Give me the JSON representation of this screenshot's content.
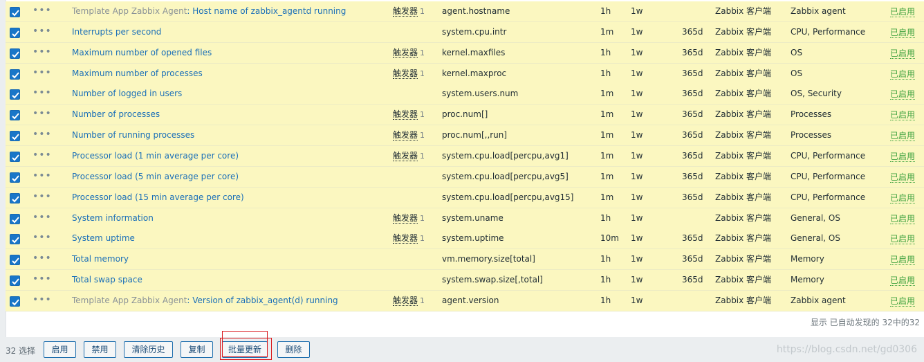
{
  "rows": [
    {
      "checked": true,
      "prefix": "Template App Zabbix Agent",
      "name": "Host name of zabbix_agentd running",
      "trigger_label": "触发器",
      "trigger_count": "1",
      "key": "agent.hostname",
      "interval": "1h",
      "history": "1w",
      "trends": "",
      "type": "Zabbix 客户端",
      "apps": "Zabbix agent",
      "status": "已启用"
    },
    {
      "checked": true,
      "prefix": "",
      "name": "Interrupts per second",
      "trigger_label": "",
      "trigger_count": "",
      "key": "system.cpu.intr",
      "interval": "1m",
      "history": "1w",
      "trends": "365d",
      "type": "Zabbix 客户端",
      "apps": "CPU, Performance",
      "status": "已启用"
    },
    {
      "checked": true,
      "prefix": "",
      "name": "Maximum number of opened files",
      "trigger_label": "触发器",
      "trigger_count": "1",
      "key": "kernel.maxfiles",
      "interval": "1h",
      "history": "1w",
      "trends": "365d",
      "type": "Zabbix 客户端",
      "apps": "OS",
      "status": "已启用"
    },
    {
      "checked": true,
      "prefix": "",
      "name": "Maximum number of processes",
      "trigger_label": "触发器",
      "trigger_count": "1",
      "key": "kernel.maxproc",
      "interval": "1h",
      "history": "1w",
      "trends": "365d",
      "type": "Zabbix 客户端",
      "apps": "OS",
      "status": "已启用"
    },
    {
      "checked": true,
      "prefix": "",
      "name": "Number of logged in users",
      "trigger_label": "",
      "trigger_count": "",
      "key": "system.users.num",
      "interval": "1m",
      "history": "1w",
      "trends": "365d",
      "type": "Zabbix 客户端",
      "apps": "OS, Security",
      "status": "已启用"
    },
    {
      "checked": true,
      "prefix": "",
      "name": "Number of processes",
      "trigger_label": "触发器",
      "trigger_count": "1",
      "key": "proc.num[]",
      "interval": "1m",
      "history": "1w",
      "trends": "365d",
      "type": "Zabbix 客户端",
      "apps": "Processes",
      "status": "已启用"
    },
    {
      "checked": true,
      "prefix": "",
      "name": "Number of running processes",
      "trigger_label": "触发器",
      "trigger_count": "1",
      "key": "proc.num[,,run]",
      "interval": "1m",
      "history": "1w",
      "trends": "365d",
      "type": "Zabbix 客户端",
      "apps": "Processes",
      "status": "已启用"
    },
    {
      "checked": true,
      "prefix": "",
      "name": "Processor load (1 min average per core)",
      "trigger_label": "触发器",
      "trigger_count": "1",
      "key": "system.cpu.load[percpu,avg1]",
      "interval": "1m",
      "history": "1w",
      "trends": "365d",
      "type": "Zabbix 客户端",
      "apps": "CPU, Performance",
      "status": "已启用"
    },
    {
      "checked": true,
      "prefix": "",
      "name": "Processor load (5 min average per core)",
      "trigger_label": "",
      "trigger_count": "",
      "key": "system.cpu.load[percpu,avg5]",
      "interval": "1m",
      "history": "1w",
      "trends": "365d",
      "type": "Zabbix 客户端",
      "apps": "CPU, Performance",
      "status": "已启用"
    },
    {
      "checked": true,
      "prefix": "",
      "name": "Processor load (15 min average per core)",
      "trigger_label": "",
      "trigger_count": "",
      "key": "system.cpu.load[percpu,avg15]",
      "interval": "1m",
      "history": "1w",
      "trends": "365d",
      "type": "Zabbix 客户端",
      "apps": "CPU, Performance",
      "status": "已启用"
    },
    {
      "checked": true,
      "prefix": "",
      "name": "System information",
      "trigger_label": "触发器",
      "trigger_count": "1",
      "key": "system.uname",
      "interval": "1h",
      "history": "1w",
      "trends": "",
      "type": "Zabbix 客户端",
      "apps": "General, OS",
      "status": "已启用"
    },
    {
      "checked": true,
      "prefix": "",
      "name": "System uptime",
      "trigger_label": "触发器",
      "trigger_count": "1",
      "key": "system.uptime",
      "interval": "10m",
      "history": "1w",
      "trends": "365d",
      "type": "Zabbix 客户端",
      "apps": "General, OS",
      "status": "已启用"
    },
    {
      "checked": true,
      "prefix": "",
      "name": "Total memory",
      "trigger_label": "",
      "trigger_count": "",
      "key": "vm.memory.size[total]",
      "interval": "1h",
      "history": "1w",
      "trends": "365d",
      "type": "Zabbix 客户端",
      "apps": "Memory",
      "status": "已启用"
    },
    {
      "checked": true,
      "prefix": "",
      "name": "Total swap space",
      "trigger_label": "",
      "trigger_count": "",
      "key": "system.swap.size[,total]",
      "interval": "1h",
      "history": "1w",
      "trends": "365d",
      "type": "Zabbix 客户端",
      "apps": "Memory",
      "status": "已启用"
    },
    {
      "checked": true,
      "prefix": "Template App Zabbix Agent",
      "name": "Version of zabbix_agent(d) running",
      "trigger_label": "触发器",
      "trigger_count": "1",
      "key": "agent.version",
      "interval": "1h",
      "history": "1w",
      "trends": "",
      "type": "Zabbix 客户端",
      "apps": "Zabbix agent",
      "status": "已启用"
    }
  ],
  "row_menu_glyph": "•••",
  "footer": {
    "summary": "显示 已自动发现的 32中的32"
  },
  "actions": {
    "selected_count": "32 选择",
    "enable": "启用",
    "disable": "禁用",
    "clear_history": "清除历史",
    "copy": "复制",
    "mass_update": "批量更新",
    "delete": "删除"
  },
  "watermark": "https://blog.csdn.net/gd0306",
  "colors": {
    "row_bg": "#fbf7c0",
    "link": "#1a6fb8",
    "status_enabled": "#40a340",
    "highlight": "#d9171c"
  }
}
